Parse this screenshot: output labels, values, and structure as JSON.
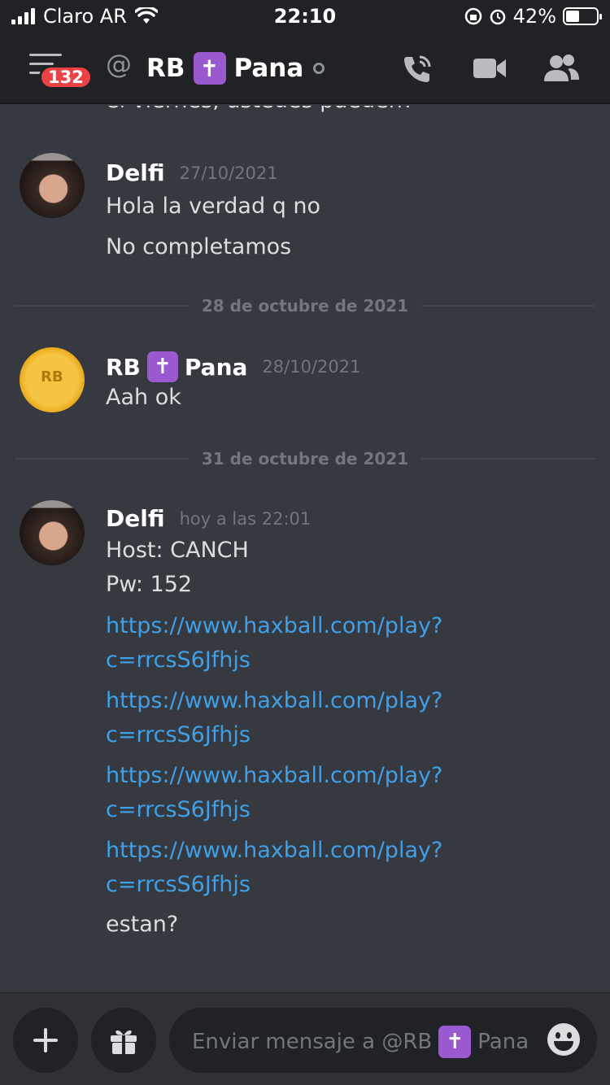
{
  "status": {
    "carrier": "Claro AR",
    "time": "22:10",
    "battery": "42%"
  },
  "header": {
    "badge": "132",
    "at": "@",
    "name_part1": "RB",
    "cross": "✝",
    "name_part2": "Pana"
  },
  "messages": {
    "cutoff": "el viernes, ustedes pueden?",
    "m1": {
      "author": "Delfi",
      "time": "27/10/2021",
      "lines": [
        "Hola la verdad q no",
        "No completamos"
      ]
    },
    "d1": "28 de octubre de 2021",
    "m2": {
      "author_part1": "RB",
      "author_part2": "Pana",
      "time": "28/10/2021",
      "lines": [
        "Aah ok"
      ]
    },
    "d2": "31 de octubre de 2021",
    "m3": {
      "author": "Delfi",
      "time": "hoy a las 22:01",
      "lines": [
        "Host: CANCH",
        "Pw: 152"
      ],
      "links": [
        [
          "https://www.haxball.com/play?",
          "c=rrcsS6Jfhjs"
        ],
        [
          "https://www.haxball.com/play?",
          "c=rrcsS6Jfhjs"
        ],
        [
          "https://www.haxball.com/play?",
          "c=rrcsS6Jfhjs"
        ],
        [
          "https://www.haxball.com/play?",
          "c=rrcsS6Jfhjs"
        ]
      ],
      "last": "estan?"
    }
  },
  "composer": {
    "placeholder_part1": "Enviar mensaje a @RB",
    "placeholder_part2": "Pana"
  },
  "colors": {
    "link": "#3fa0e8",
    "badge": "#ed4245",
    "cross_bg": "#9b59d0"
  },
  "icons": [
    "menu-icon",
    "at-icon",
    "call-icon",
    "video-icon",
    "members-icon",
    "plus-icon",
    "gift-icon",
    "emoji-icon"
  ]
}
